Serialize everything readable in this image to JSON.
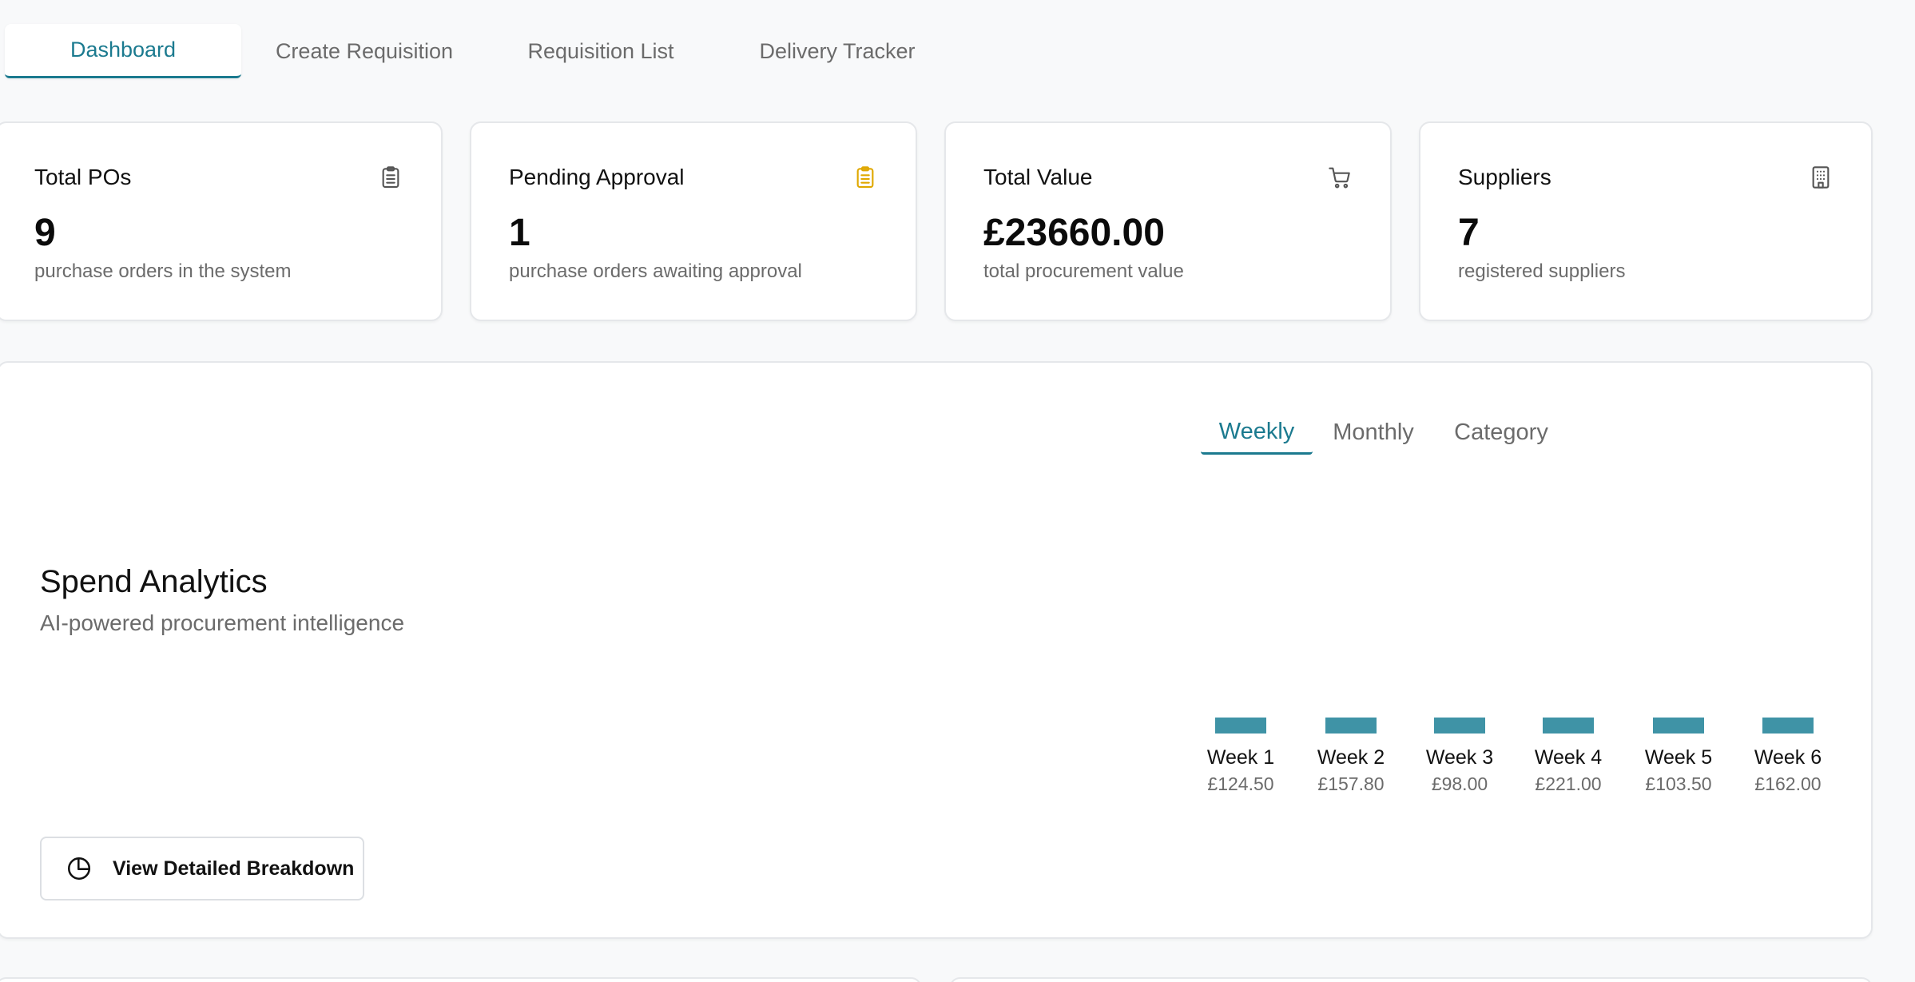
{
  "nav": {
    "tabs": [
      {
        "label": "Dashboard",
        "active": true
      },
      {
        "label": "Create Requisition",
        "active": false
      },
      {
        "label": "Requisition List",
        "active": false
      },
      {
        "label": "Delivery Tracker",
        "active": false
      }
    ]
  },
  "stats": [
    {
      "label": "Total POs",
      "value": "9",
      "desc": "purchase orders in the system",
      "icon": "clipboard-icon"
    },
    {
      "label": "Pending Approval",
      "value": "1",
      "desc": "purchase orders awaiting approval",
      "icon": "clipboard-pending-icon"
    },
    {
      "label": "Total Value",
      "value": "£23660.00",
      "desc": "total procurement value",
      "icon": "cart-icon"
    },
    {
      "label": "Suppliers",
      "value": "7",
      "desc": "registered suppliers",
      "icon": "building-icon"
    }
  ],
  "analytics": {
    "title": "Spend Analytics",
    "subtitle": "AI-powered procurement intelligence",
    "tabs": [
      {
        "label": "Weekly",
        "active": true
      },
      {
        "label": "Monthly",
        "active": false
      },
      {
        "label": "Category",
        "active": false
      }
    ],
    "button_label": "View Detailed Breakdown",
    "button_icon": "pie-chart-icon"
  },
  "colors": {
    "accent": "#1b7a8f",
    "bar": "#3f93a6",
    "pending_icon": "#e0a800"
  },
  "chart_data": {
    "type": "bar",
    "categories": [
      "Week 1",
      "Week 2",
      "Week 3",
      "Week 4",
      "Week 5",
      "Week 6"
    ],
    "values": [
      124.5,
      157.8,
      98.0,
      221.0,
      103.5,
      162.0
    ],
    "value_labels": [
      "£124.50",
      "£157.80",
      "£98.00",
      "£221.00",
      "£103.50",
      "£162.00"
    ]
  }
}
